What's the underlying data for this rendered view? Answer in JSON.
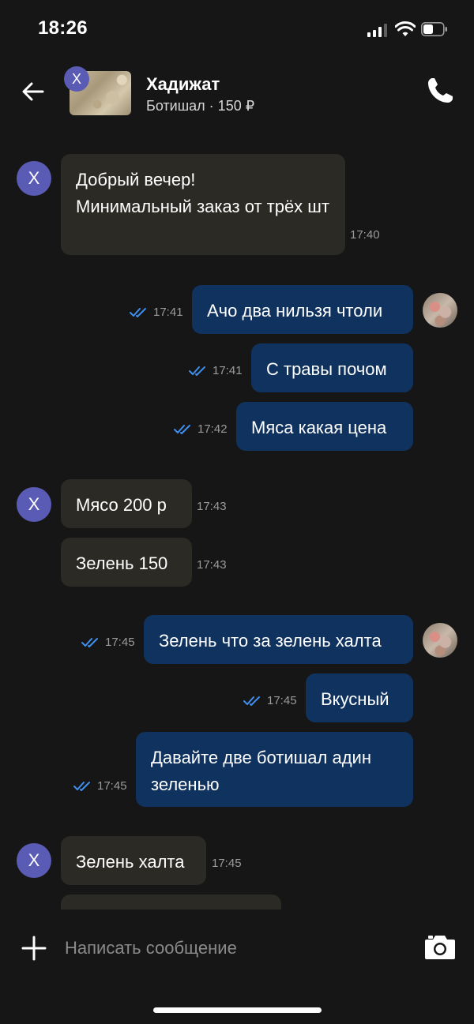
{
  "status_bar": {
    "time": "18:26"
  },
  "header": {
    "name": "Хадижат",
    "subtitle": "Ботишал · 150 ₽",
    "avatar_letter": "X"
  },
  "messages": [
    {
      "side": "in",
      "text": "Добрый вечер!\nМинимальный заказ от трёх шт",
      "time": "17:40"
    },
    {
      "side": "out",
      "text": "Ачо два нильзя чтоли",
      "time": "17:41"
    },
    {
      "side": "out",
      "text": "С травы почом",
      "time": "17:41"
    },
    {
      "side": "out",
      "text": "Мяса какая цена",
      "time": "17:42"
    },
    {
      "side": "in",
      "text": "Мясо 200 р",
      "time": "17:43"
    },
    {
      "side": "in",
      "text": "Зелень 150",
      "time": "17:43"
    },
    {
      "side": "out",
      "text": "Зелень что за зелень халта",
      "time": "17:45"
    },
    {
      "side": "out",
      "text": "Вкусный",
      "time": "17:45"
    },
    {
      "side": "out",
      "text": "Давайте две ботишал адин\nзеленью",
      "time": "17:45"
    },
    {
      "side": "in",
      "text": "Зелень халта",
      "time": "17:45"
    }
  ],
  "composer": {
    "placeholder": "Написать сообщение"
  },
  "colors": {
    "incoming_bubble": "#2c2a25",
    "outgoing_bubble": "#10325f",
    "avatar": "#5a5bb5",
    "read_check": "#3f8ff0"
  }
}
